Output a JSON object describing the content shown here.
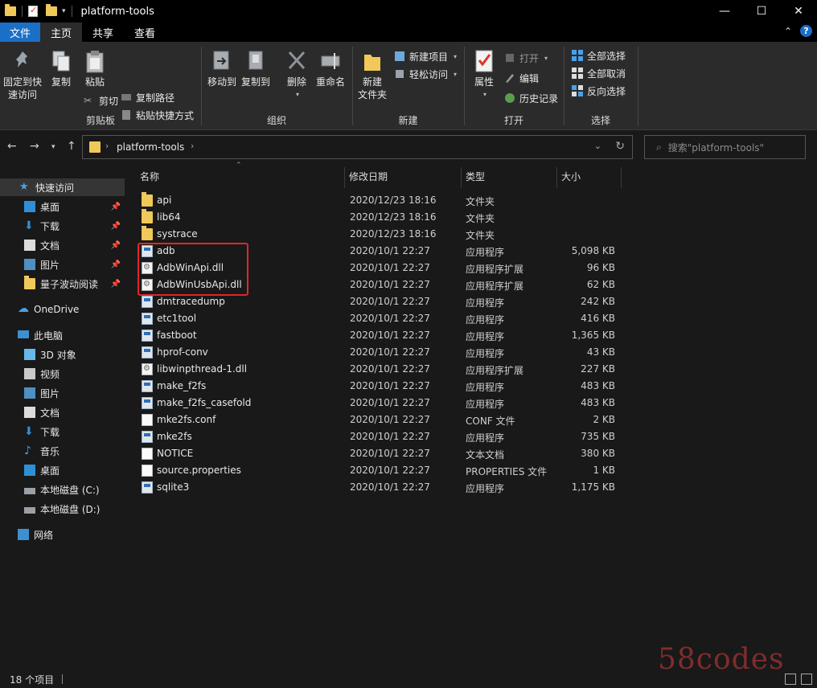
{
  "window": {
    "title": "platform-tools",
    "controls": {
      "minimize": "—",
      "maximize": "☐",
      "close": "✕"
    }
  },
  "tabs": [
    {
      "label": "文件"
    },
    {
      "label": "主页"
    },
    {
      "label": "共享"
    },
    {
      "label": "查看"
    }
  ],
  "ribbon": {
    "clipboard": {
      "label": "剪贴板",
      "pin": [
        "固定到快",
        "速访问"
      ],
      "copy": "复制",
      "paste": "粘贴",
      "copy_path": "复制路径",
      "paste_shortcut": "粘贴快捷方式",
      "cut": "剪切"
    },
    "organize": {
      "label": "组织",
      "move_to": "移动到",
      "copy_to": "复制到",
      "delete": "删除",
      "rename": "重命名"
    },
    "new": {
      "label": "新建",
      "new_folder": [
        "新建",
        "文件夹"
      ],
      "new_item": "新建项目",
      "easy_access": "轻松访问"
    },
    "open": {
      "label": "打开",
      "properties": "属性",
      "open": "打开",
      "edit": "编辑",
      "history": "历史记录"
    },
    "select": {
      "label": "选择",
      "select_all": "全部选择",
      "select_none": "全部取消",
      "invert": "反向选择"
    }
  },
  "address": {
    "path": "platform-tools",
    "search_placeholder": "搜索\"platform-tools\""
  },
  "nav": {
    "quick_access": "快速访问",
    "quick_items": [
      "桌面",
      "下载",
      "文档",
      "图片",
      "量子波动阅读"
    ],
    "onedrive": "OneDrive",
    "this_pc": "此电脑",
    "pc_items": [
      "3D 对象",
      "视频",
      "图片",
      "文档",
      "下载",
      "音乐",
      "桌面",
      "本地磁盘 (C:)",
      "本地磁盘 (D:)"
    ],
    "network": "网络"
  },
  "columns": {
    "name": "名称",
    "date": "修改日期",
    "type": "类型",
    "size": "大小"
  },
  "files": [
    {
      "name": "api",
      "date": "2020/12/23 18:16",
      "type": "文件夹",
      "size": "",
      "icon": "folder"
    },
    {
      "name": "lib64",
      "date": "2020/12/23 18:16",
      "type": "文件夹",
      "size": "",
      "icon": "folder"
    },
    {
      "name": "systrace",
      "date": "2020/12/23 18:16",
      "type": "文件夹",
      "size": "",
      "icon": "folder"
    },
    {
      "name": "adb",
      "date": "2020/10/1 22:27",
      "type": "应用程序",
      "size": "5,098 KB",
      "icon": "exe"
    },
    {
      "name": "AdbWinApi.dll",
      "date": "2020/10/1 22:27",
      "type": "应用程序扩展",
      "size": "96 KB",
      "icon": "dll"
    },
    {
      "name": "AdbWinUsbApi.dll",
      "date": "2020/10/1 22:27",
      "type": "应用程序扩展",
      "size": "62 KB",
      "icon": "dll"
    },
    {
      "name": "dmtracedump",
      "date": "2020/10/1 22:27",
      "type": "应用程序",
      "size": "242 KB",
      "icon": "exe"
    },
    {
      "name": "etc1tool",
      "date": "2020/10/1 22:27",
      "type": "应用程序",
      "size": "416 KB",
      "icon": "exe"
    },
    {
      "name": "fastboot",
      "date": "2020/10/1 22:27",
      "type": "应用程序",
      "size": "1,365 KB",
      "icon": "exe"
    },
    {
      "name": "hprof-conv",
      "date": "2020/10/1 22:27",
      "type": "应用程序",
      "size": "43 KB",
      "icon": "exe"
    },
    {
      "name": "libwinpthread-1.dll",
      "date": "2020/10/1 22:27",
      "type": "应用程序扩展",
      "size": "227 KB",
      "icon": "dll"
    },
    {
      "name": "make_f2fs",
      "date": "2020/10/1 22:27",
      "type": "应用程序",
      "size": "483 KB",
      "icon": "exe"
    },
    {
      "name": "make_f2fs_casefold",
      "date": "2020/10/1 22:27",
      "type": "应用程序",
      "size": "483 KB",
      "icon": "exe"
    },
    {
      "name": "mke2fs.conf",
      "date": "2020/10/1 22:27",
      "type": "CONF 文件",
      "size": "2 KB",
      "icon": "file"
    },
    {
      "name": "mke2fs",
      "date": "2020/10/1 22:27",
      "type": "应用程序",
      "size": "735 KB",
      "icon": "exe"
    },
    {
      "name": "NOTICE",
      "date": "2020/10/1 22:27",
      "type": "文本文档",
      "size": "380 KB",
      "icon": "file"
    },
    {
      "name": "source.properties",
      "date": "2020/10/1 22:27",
      "type": "PROPERTIES 文件",
      "size": "1 KB",
      "icon": "file"
    },
    {
      "name": "sqlite3",
      "date": "2020/10/1 22:27",
      "type": "应用程序",
      "size": "1,175 KB",
      "icon": "exe"
    }
  ],
  "status": {
    "count": "18 个项目"
  },
  "watermark": "58codes"
}
